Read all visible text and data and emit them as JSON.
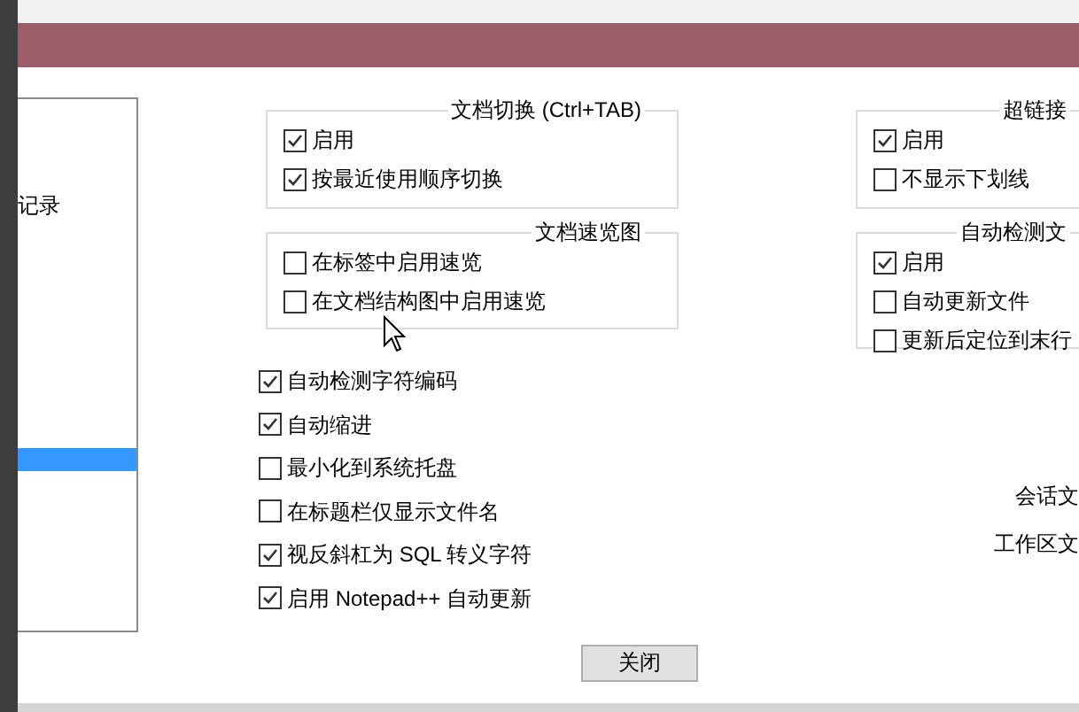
{
  "list": {
    "items": [
      {
        "label": "记录",
        "selected": false
      },
      {
        "selected": true
      }
    ]
  },
  "groups": [
    {
      "title": "文档切换 (Ctrl+TAB)",
      "options": [
        {
          "label": "启用",
          "checked": true
        },
        {
          "label": "按最近使用顺序切换",
          "checked": true
        }
      ]
    },
    {
      "title": "文档速览图",
      "options": [
        {
          "label": "在标签中启用速览",
          "checked": false
        },
        {
          "label": "在文档结构图中启用速览",
          "checked": false
        }
      ]
    }
  ],
  "options": [
    {
      "label": "自动检测字符编码",
      "checked": true
    },
    {
      "label": "自动缩进",
      "checked": true
    },
    {
      "label": "最小化到系统托盘",
      "checked": false
    },
    {
      "label": "在标题栏仅显示文件名",
      "checked": false
    },
    {
      "label": "视反斜杠为 SQL 转义字符",
      "checked": true
    },
    {
      "label": "启用 Notepad++ 自动更新",
      "checked": true
    }
  ],
  "right_groups": [
    {
      "title": "超链接",
      "options": [
        {
          "label": "启用",
          "checked": true
        },
        {
          "label": "不显示下划线",
          "checked": false
        }
      ]
    },
    {
      "title": "自动检测文",
      "options": [
        {
          "label": "启用",
          "checked": true
        },
        {
          "label": "自动更新文件",
          "checked": false
        },
        {
          "label": "更新后定位到末行",
          "checked": false
        }
      ]
    }
  ],
  "right_labels": [
    "会话文",
    "工作区文"
  ],
  "close_button": "关闭"
}
